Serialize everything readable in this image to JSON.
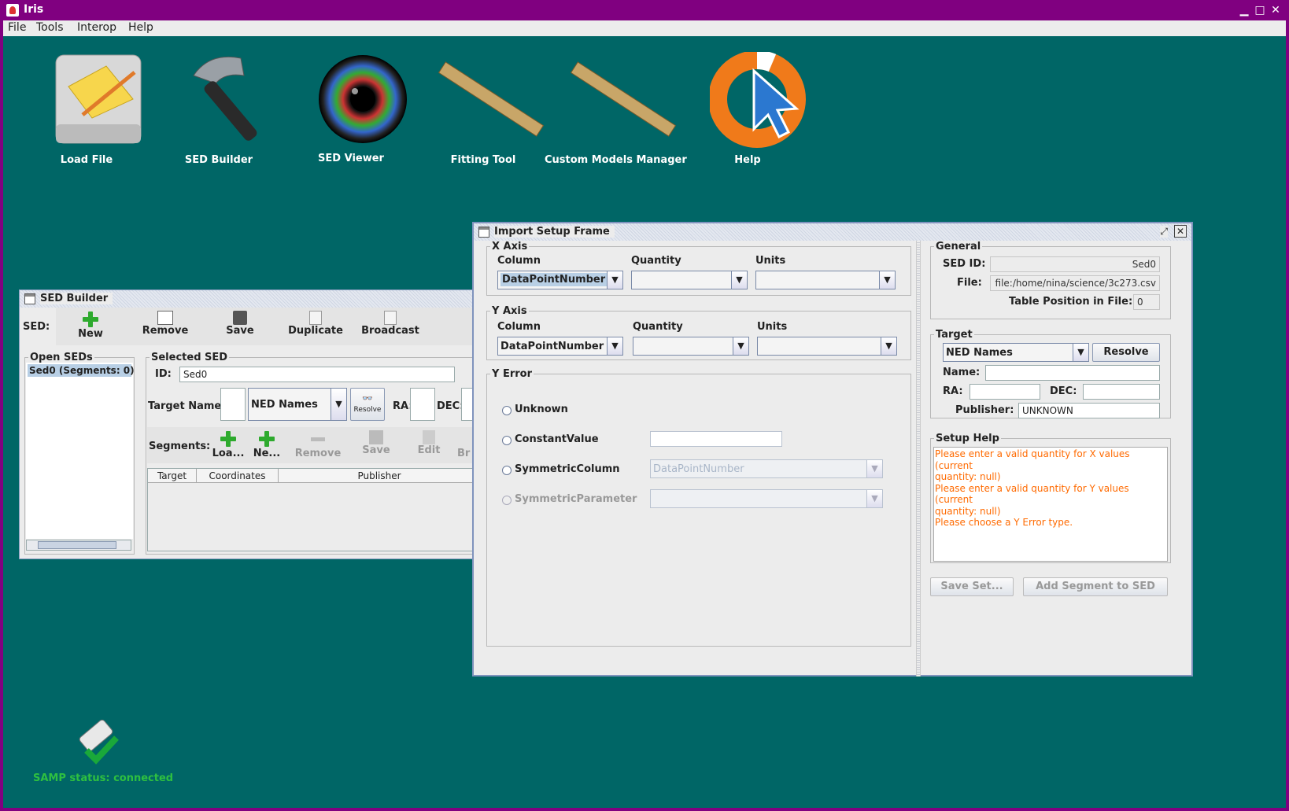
{
  "window": {
    "title": "Iris"
  },
  "menu": [
    "File",
    "Tools",
    "Interop",
    "Help"
  ],
  "desktop_icons": {
    "load_file": "Load File",
    "sed_builder": "SED Builder",
    "sed_viewer": "SED Viewer",
    "fitting_tool": "Fitting Tool",
    "custom_models": "Custom Models Manager",
    "help": "Help"
  },
  "samp": {
    "status": "SAMP status: connected"
  },
  "sed_builder": {
    "title": "SED Builder",
    "sed_label": "SED:",
    "toolbar": [
      "New",
      "Remove",
      "Save",
      "Duplicate",
      "Broadcast"
    ],
    "open_seds_label": "Open SEDs",
    "open_seds": [
      "Sed0 (Segments: 0)"
    ],
    "selected_sed_label": "Selected SED",
    "id_label": "ID:",
    "id_value": "Sed0",
    "target_name_label": "Target Name:",
    "resolver": "NED Names",
    "resolve_label": "Resolve",
    "ra_label": "RA:",
    "dec_label": "DEC:",
    "segments_label": "Segments:",
    "segment_buttons": [
      "Loa...",
      "Ne...",
      "Remove",
      "Save",
      "Edit",
      "Br"
    ],
    "table_headers": [
      "Target",
      "Coordinates",
      "Publisher"
    ]
  },
  "import_setup": {
    "title": "Import Setup Frame",
    "x_axis": {
      "legend": "X Axis",
      "column_label": "Column",
      "quantity_label": "Quantity",
      "units_label": "Units",
      "column_value": "DataPointNumber"
    },
    "y_axis": {
      "legend": "Y Axis",
      "column_label": "Column",
      "quantity_label": "Quantity",
      "units_label": "Units",
      "column_value": "DataPointNumber"
    },
    "y_error": {
      "legend": "Y Error",
      "options": [
        "Unknown",
        "ConstantValue",
        "SymmetricColumn",
        "SymmetricParameter"
      ],
      "symmetric_column_value": "DataPointNumber"
    },
    "general": {
      "legend": "General",
      "sed_id_label": "SED ID:",
      "sed_id_value": "Sed0",
      "file_label": "File:",
      "file_value": "file:/home/nina/science/3c273.csv",
      "table_pos_label": "Table Position in File:",
      "table_pos_value": "0"
    },
    "target": {
      "legend": "Target",
      "resolver": "NED Names",
      "resolve_button": "Resolve",
      "name_label": "Name:",
      "ra_label": "RA:",
      "dec_label": "DEC:",
      "publisher_label": "Publisher:",
      "publisher_value": "UNKNOWN"
    },
    "setup_help": {
      "legend": "Setup Help",
      "lines": [
        "Please enter a valid quantity for X values (current",
        "quantity: null)",
        "Please enter a valid quantity for Y values (current",
        "quantity: null)",
        "Please choose a Y Error type."
      ]
    },
    "save_set_button": "Save Set...",
    "add_segment_button": "Add Segment to SED"
  }
}
